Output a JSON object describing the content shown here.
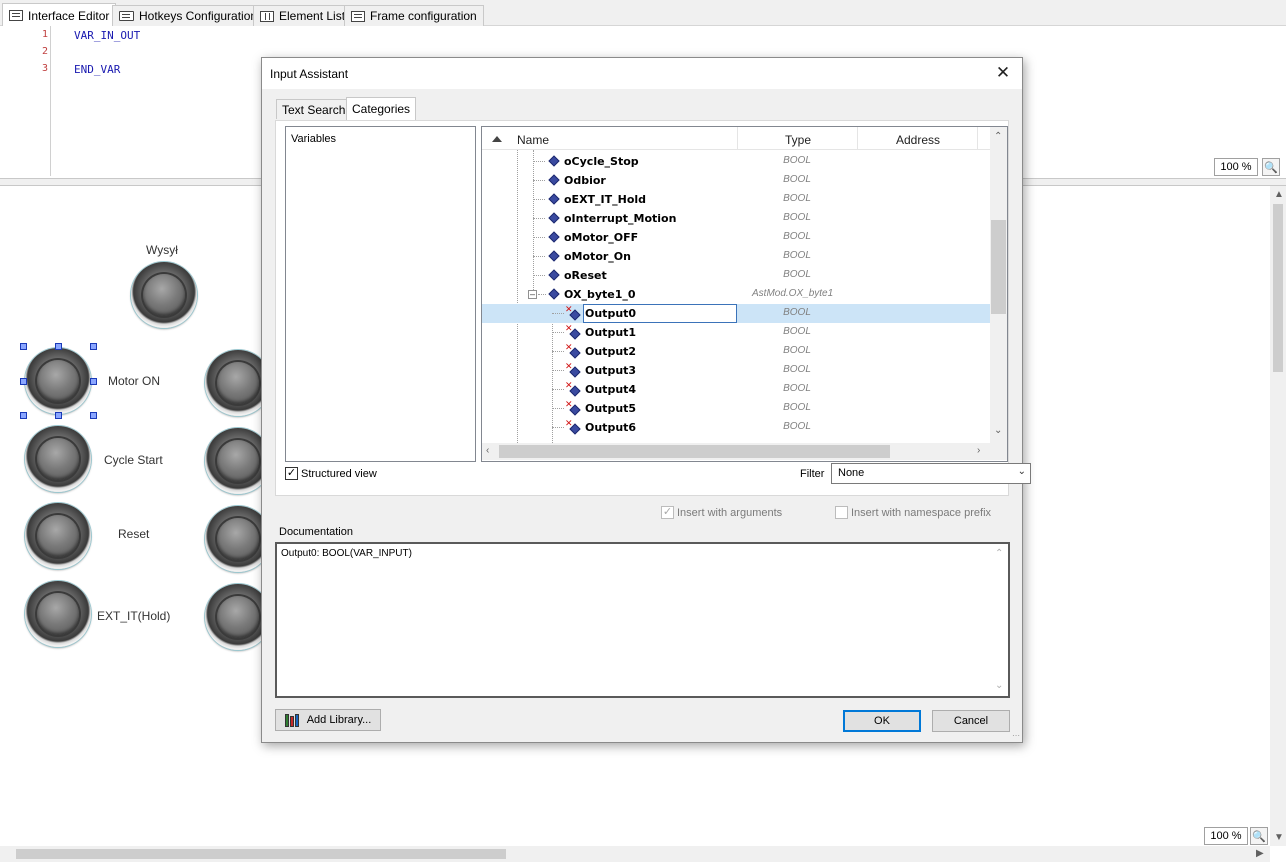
{
  "tabs": [
    {
      "label": "Interface Editor",
      "active": true
    },
    {
      "label": "Hotkeys Configuration",
      "active": false
    },
    {
      "label": "Element List",
      "active": false
    },
    {
      "label": "Frame configuration",
      "active": false
    }
  ],
  "editor": {
    "lines": [
      {
        "no": "1",
        "code": "VAR_IN_OUT"
      },
      {
        "no": "2",
        "code": ""
      },
      {
        "no": "3",
        "code": "END_VAR"
      }
    ],
    "zoom": "100 %"
  },
  "canvas": {
    "zoom": "100 %",
    "buttons": [
      {
        "label": "Wysył"
      },
      {
        "label": "Motor ON"
      },
      {
        "label": "Cycle Start"
      },
      {
        "label": "Reset"
      },
      {
        "label": "EXT_IT(Hold)"
      }
    ]
  },
  "dialog": {
    "title": "Input Assistant",
    "close_glyph": "✕",
    "tabs": [
      "Text Search",
      "Categories"
    ],
    "active_tab": "Categories",
    "categories": [
      "Variables"
    ],
    "columns": {
      "name": "Name",
      "type": "Type",
      "address": "Address"
    },
    "rows": [
      {
        "name": "oCycle_Stop",
        "type": "BOOL"
      },
      {
        "name": "Odbior",
        "type": "BOOL"
      },
      {
        "name": "oEXT_IT_Hold",
        "type": "BOOL"
      },
      {
        "name": "oInterrupt_Motion",
        "type": "BOOL"
      },
      {
        "name": "oMotor_OFF",
        "type": "BOOL"
      },
      {
        "name": "oMotor_On",
        "type": "BOOL"
      },
      {
        "name": "oReset",
        "type": "BOOL"
      },
      {
        "name": "OX_byte1_0",
        "type": "AstMod.OX_byte1"
      },
      {
        "name": "Output0",
        "type": "BOOL"
      },
      {
        "name": "Output1",
        "type": "BOOL"
      },
      {
        "name": "Output2",
        "type": "BOOL"
      },
      {
        "name": "Output3",
        "type": "BOOL"
      },
      {
        "name": "Output4",
        "type": "BOOL"
      },
      {
        "name": "Output5",
        "type": "BOOL"
      },
      {
        "name": "Output6",
        "type": "BOOL"
      }
    ],
    "selected_row": "Output0",
    "structured_view": {
      "label": "Structured view",
      "checked": true
    },
    "filter": {
      "label": "Filter",
      "value": "None"
    },
    "insert_with_arguments": {
      "label": "Insert with arguments",
      "checked": true,
      "enabled": false
    },
    "insert_with_namespace": {
      "label": "Insert with namespace prefix",
      "checked": false,
      "enabled": false
    },
    "documentation": {
      "label": "Documentation",
      "text": "Output0: BOOL(VAR_INPUT)"
    },
    "add_library": "Add Library...",
    "ok": "OK",
    "cancel": "Cancel"
  },
  "colors": {
    "selection": "#cce4f7",
    "code": "#1a1ab0",
    "accent": "#0078d7"
  }
}
